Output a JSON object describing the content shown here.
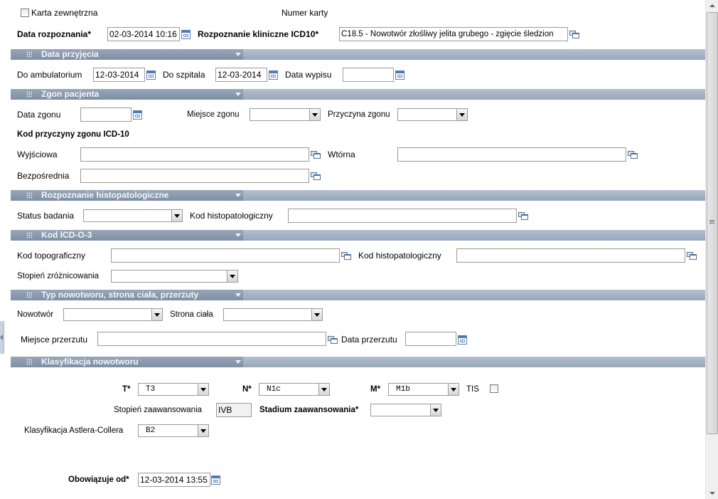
{
  "header": {
    "external_card_label": "Karta zewnętrzna",
    "external_card_checked": false,
    "card_number_label": "Numer karty",
    "diagnosis_date_label": "Data rozpoznania*",
    "diagnosis_date_value": "02-03-2014 10:16",
    "icd10_label": "Rozpoznanie kliniczne ICD10*",
    "icd10_value": "C18.5 - Nowotwór złośliwy jelita grubego - zgięcie śledzion"
  },
  "admission": {
    "title": "Data przyjęcia",
    "outpatient_label": "Do ambulatorium",
    "outpatient_value": "12-03-2014",
    "hospital_label": "Do szpitala",
    "hospital_value": "12-03-2014",
    "discharge_label": "Data wypisu",
    "discharge_value": ""
  },
  "death": {
    "title": "Zgon pacjenta",
    "date_label": "Data zgonu",
    "date_value": "",
    "place_label": "Miejsce zgonu",
    "place_value": "",
    "cause_label": "Przyczyna zgonu",
    "cause_value": "",
    "icd_heading": "Kod przyczyny zgonu ICD-10",
    "initial_label": "Wyjściowa",
    "initial_value": "",
    "secondary_label": "Wtórna",
    "secondary_value": "",
    "direct_label": "Bezpośrednia",
    "direct_value": ""
  },
  "histopathology": {
    "title": "Rozpoznanie histopatologiczne",
    "status_label": "Status badania",
    "status_value": "",
    "code_label": "Kod histopatologiczny",
    "code_value": ""
  },
  "icdo3": {
    "title": "Kod ICD-O-3",
    "topo_label": "Kod topograficzny",
    "topo_value": "",
    "histo_label": "Kod histopatologiczny",
    "histo_value": "",
    "grade_label": "Stopień zróżnicowania",
    "grade_value": ""
  },
  "tumor_type": {
    "title": "Typ nowotworu, strona ciała, przerzuty",
    "tumor_label": "Nowotwór",
    "tumor_value": "",
    "side_label": "Strona ciała",
    "side_value": "",
    "meta_place_label": "Miejsce przerzutu",
    "meta_place_value": "",
    "meta_date_label": "Data przerzutu",
    "meta_date_value": ""
  },
  "classification": {
    "title": "Klasyfikacja nowotworu",
    "t_label": "T*",
    "t_value": "T3",
    "n_label": "N*",
    "n_value": "N1c",
    "m_label": "M*",
    "m_value": "M1b",
    "tis_label": "TIS",
    "tis_checked": false,
    "stage_label": "Stopień zaawansowania",
    "stage_value": "IVB",
    "stadium_label": "Stadium zaawansowania*",
    "stadium_value": "",
    "astler_label": "Klasyfikacja Astlera-Collera",
    "astler_value": "B2",
    "valid_from_label": "Obowiązuje od*",
    "valid_from_value": "12-03-2014 13:55"
  },
  "colors": {
    "section_bar": "#a7b4c6",
    "section_bar_dark": "#8797ad",
    "border": "#9a9a9a"
  }
}
